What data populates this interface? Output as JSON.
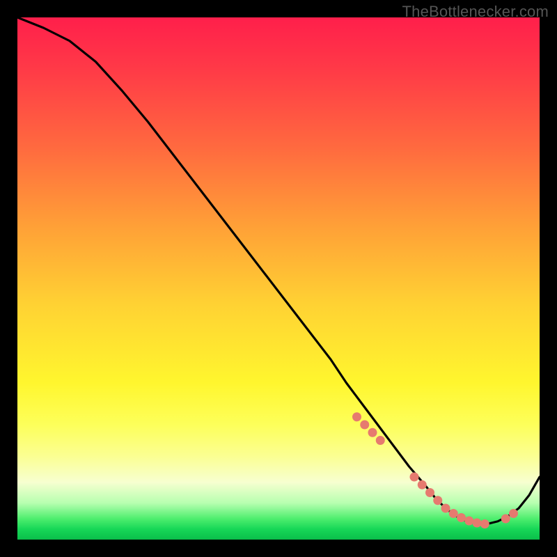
{
  "attribution": "TheBottlenecker.com",
  "chart_data": {
    "type": "line",
    "title": "",
    "xlabel": "",
    "ylabel": "",
    "x_range": [
      0,
      100
    ],
    "y_range": [
      0,
      100
    ],
    "description": "Bottleneck curve over rainbow gradient (red=high bottleneck at top, green=optimal at bottom). Single black curve descends from top-left to a minimum near x≈82 then rises toward the right edge. Salmon dots mark the near-optimal region along the curve.",
    "series": [
      {
        "name": "curve",
        "color": "#000000",
        "x": [
          0,
          5,
          10,
          15,
          20,
          25,
          30,
          35,
          40,
          45,
          50,
          55,
          60,
          63,
          66,
          69,
          72,
          75,
          78,
          80,
          82,
          84,
          86,
          88,
          90,
          92,
          94,
          96,
          98,
          100
        ],
        "y": [
          100,
          98,
          95.5,
          91.5,
          86,
          80,
          73.5,
          67,
          60.5,
          54,
          47.5,
          41,
          34.5,
          30,
          26,
          22,
          18,
          14,
          10.5,
          8,
          6,
          4.5,
          3.5,
          3,
          3,
          3.5,
          4.5,
          6,
          8.5,
          12
        ]
      },
      {
        "name": "optimal-markers",
        "color": "#e67a6f",
        "x": [
          65,
          66.5,
          68,
          69.5,
          76,
          77.5,
          79,
          80.5,
          82,
          83.5,
          85,
          86.5,
          88,
          89.5,
          93.5,
          95
        ],
        "y": [
          23.5,
          22,
          20.5,
          19,
          12,
          10.5,
          9,
          7.5,
          6,
          5,
          4.2,
          3.6,
          3.2,
          3,
          4,
          5
        ]
      }
    ]
  }
}
